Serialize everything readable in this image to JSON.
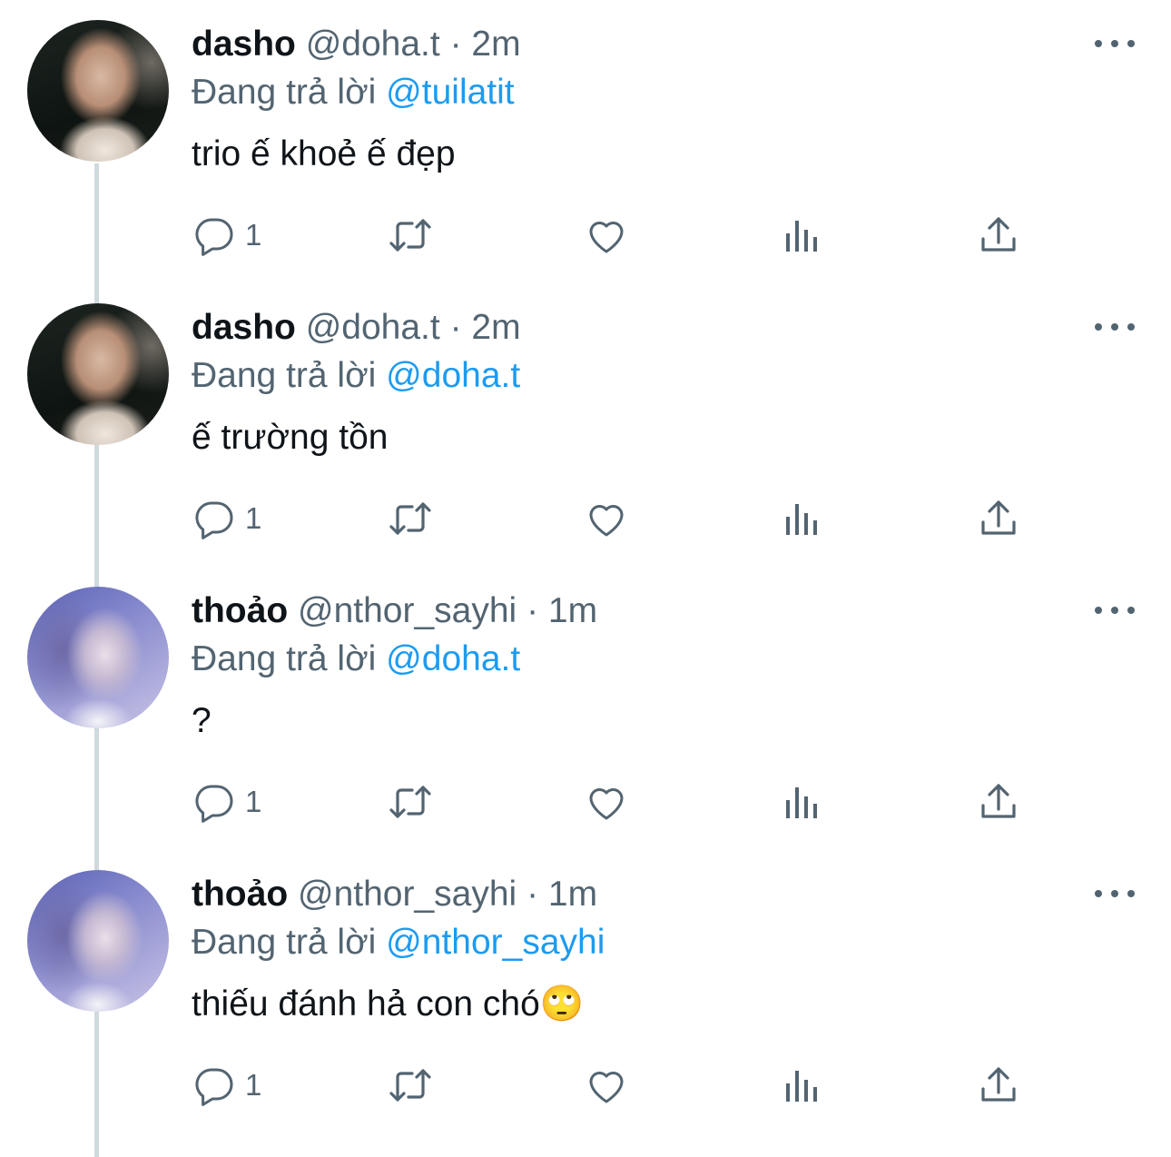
{
  "tweets": [
    {
      "name": "dasho",
      "handle": "@doha.t",
      "time": "· 2m",
      "reply_prefix": "Đang trả lời",
      "reply_to": "@tuilatit",
      "text": "trio ế khoẻ ế đẹp",
      "reply_count": "1",
      "avatar_style": "dark"
    },
    {
      "name": "dasho",
      "handle": "@doha.t",
      "time": "· 2m",
      "reply_prefix": "Đang trả lời",
      "reply_to": "@doha.t",
      "text": "ế trường tồn",
      "reply_count": "1",
      "avatar_style": "dark"
    },
    {
      "name": "thoảo",
      "handle": "@nthor_sayhi",
      "time": "· 1m",
      "reply_prefix": "Đang trả lời",
      "reply_to": "@doha.t",
      "text": "?",
      "reply_count": "1",
      "avatar_style": "blue"
    },
    {
      "name": "thoảo",
      "handle": "@nthor_sayhi",
      "time": "· 1m",
      "reply_prefix": "Đang trả lời",
      "reply_to": "@nthor_sayhi",
      "text": "thiếu đánh hả con chó🙄",
      "reply_count": "1",
      "avatar_style": "blue"
    }
  ],
  "colors": {
    "mention": "#1d9bf0",
    "secondary_text": "#536471",
    "thread_line": "#cfd9de"
  },
  "icons": [
    "reply-icon",
    "retweet-icon",
    "like-icon",
    "views-icon",
    "share-icon",
    "more-icon"
  ]
}
